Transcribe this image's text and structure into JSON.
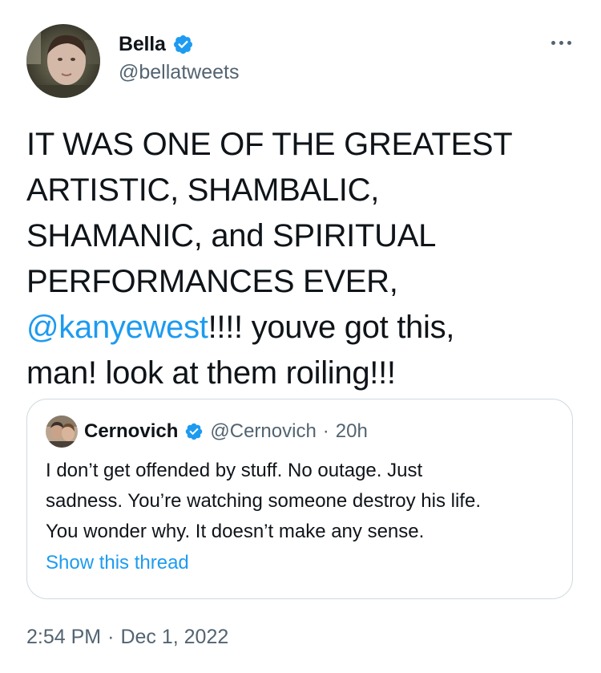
{
  "author": {
    "display_name": "Bella",
    "handle": "@bellatweets",
    "verified": true
  },
  "tweet": {
    "text_line_1": "IT WAS ONE OF THE GREATEST\nARTISTIC, SHAMBALIC,\nSHAMANIC, and SPIRITUAL\nPERFORMANCES EVER,\n",
    "mention": "@kanyewest",
    "text_line_2": "!!!! youve got this,\nman! look at them roiling!!!"
  },
  "quoted_tweet": {
    "display_name": "Cernovich",
    "handle": "@Cernovich",
    "separator": "·",
    "time": "20h",
    "text": "I don’t get offended by stuff. No outage. Just\nsadness. You’re watching someone destroy his life.\nYou wonder why. It doesn’t make any sense.",
    "show_thread_label": "Show this thread"
  },
  "footer": {
    "time": "2:54 PM",
    "separator": "·",
    "date": "Dec 1, 2022"
  },
  "icons": {
    "verified": "verified-badge-icon",
    "more": "more-horizontal-icon"
  },
  "colors": {
    "accent": "#1d9bf0",
    "text_primary": "#0f1419",
    "text_secondary": "#536471",
    "border": "#cfd9de"
  }
}
